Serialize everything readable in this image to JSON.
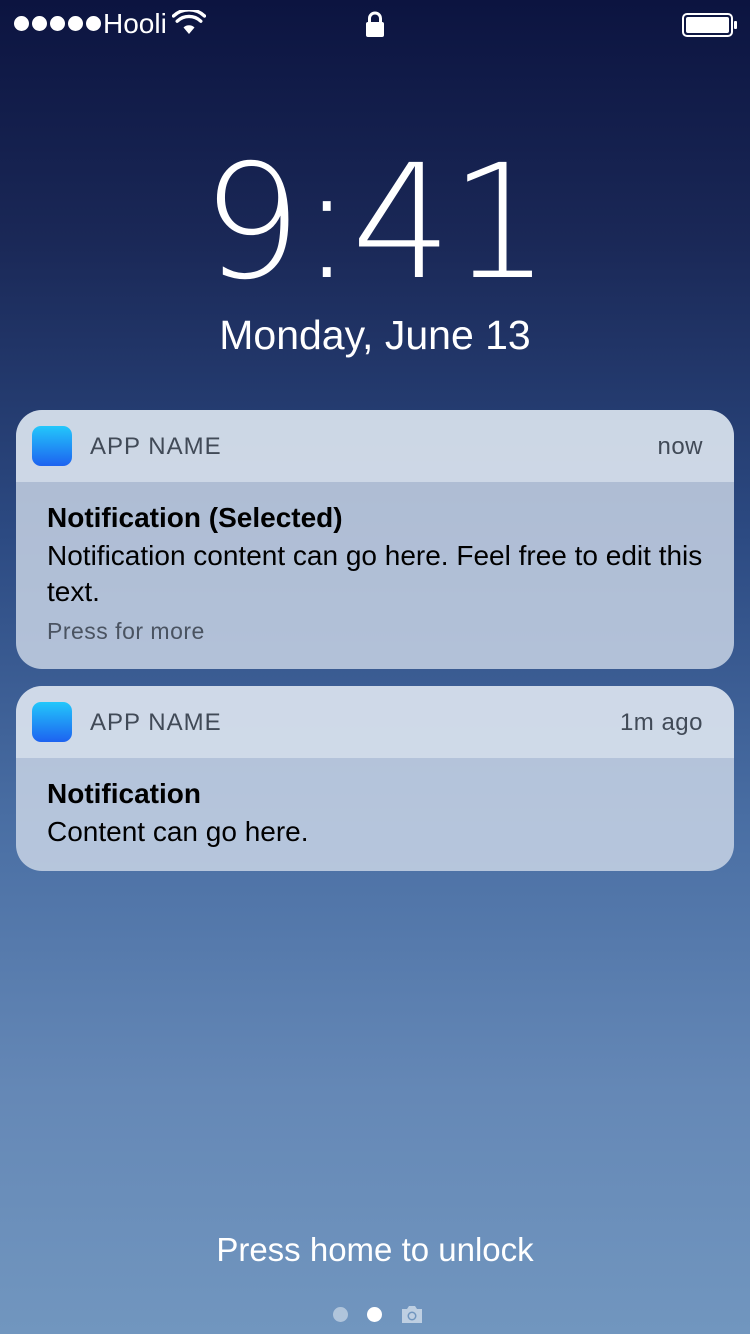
{
  "status_bar": {
    "signal_dots": 5,
    "carrier": "Hooli",
    "wifi_icon": "wifi-icon",
    "lock_icon": "lock-icon",
    "battery_icon": "battery-full-icon"
  },
  "lock_screen": {
    "time": "9:41",
    "date": "Monday, June 13"
  },
  "notifications": [
    {
      "app_name": "APP NAME",
      "time": "now",
      "title": "Notification (Selected)",
      "text": "Notification content can go here. Feel free to edit this text.",
      "more": "Press for more"
    },
    {
      "app_name": "APP NAME",
      "time": "1m ago",
      "title": "Notification",
      "text": "Content can go here."
    }
  ],
  "footer": {
    "unlock_hint": "Press home to unlock",
    "page_count": 2,
    "active_page": 2,
    "camera_icon": "camera-icon"
  },
  "colors": {
    "app_icon_top": "#23c7fb",
    "app_icon_bottom": "#1d62f0"
  }
}
